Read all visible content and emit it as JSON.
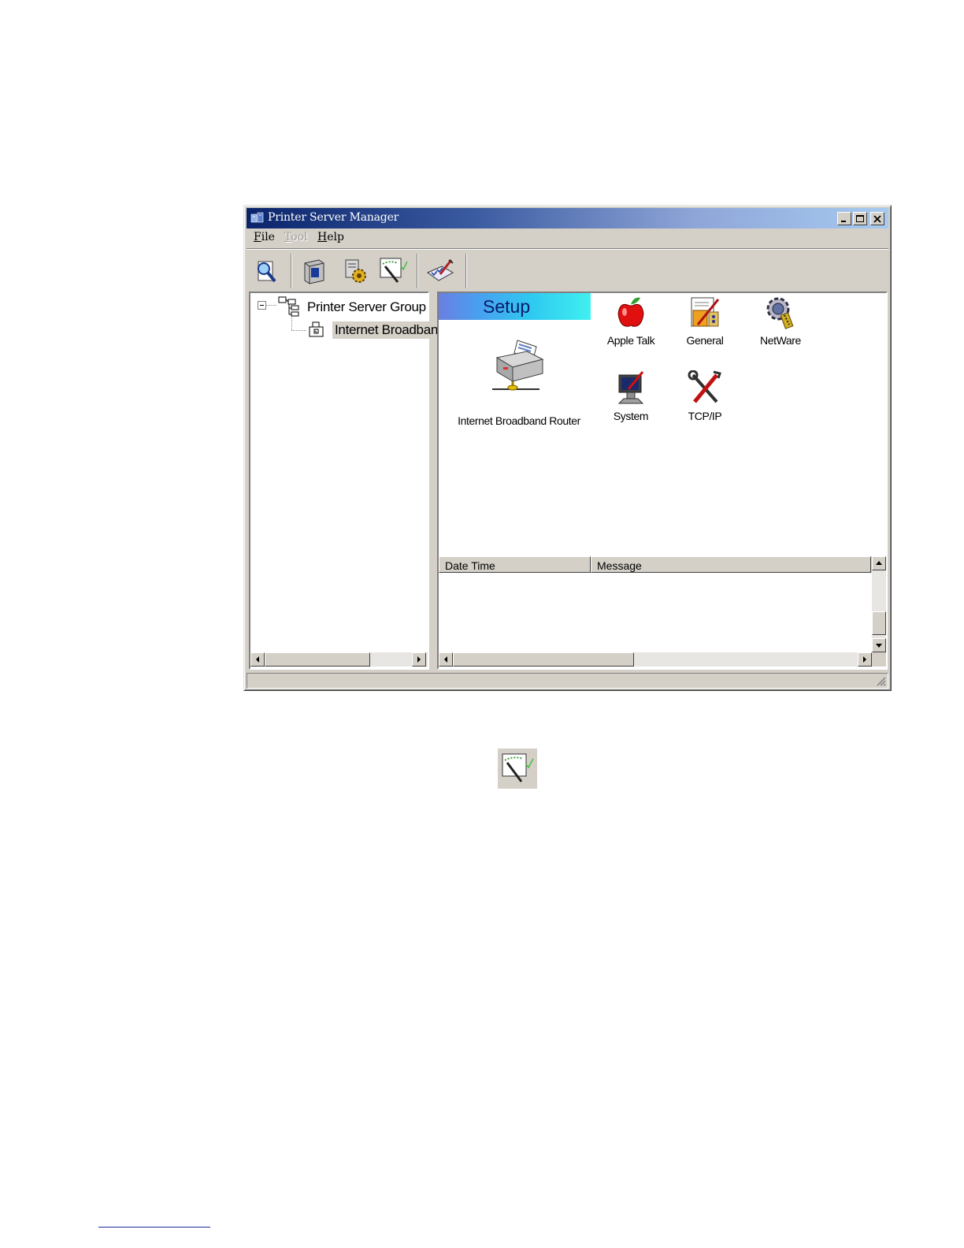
{
  "window": {
    "title": "Printer Server Manager"
  },
  "menu": {
    "items": [
      {
        "label": "File",
        "enabled": true
      },
      {
        "label": "Tool",
        "enabled": false
      },
      {
        "label": "Help",
        "enabled": true
      }
    ]
  },
  "toolbar": {
    "buttons": [
      "search-icon",
      "device-icon",
      "settings-gear-icon",
      "wizard-icon",
      "checklist-icon"
    ]
  },
  "tree": {
    "root_label": "Printer Server Group",
    "child_label": "Internet Broadband Router"
  },
  "setup": {
    "banner_label": "Setup",
    "device_label": "Internet Broadband Router",
    "icons": [
      {
        "label": "Apple Talk",
        "icon": "apple-icon"
      },
      {
        "label": "General",
        "icon": "general-icon"
      },
      {
        "label": "NetWare",
        "icon": "netware-gear-icon"
      },
      {
        "label": "System",
        "icon": "computer-icon"
      },
      {
        "label": "TCP/IP",
        "icon": "tools-icon"
      }
    ]
  },
  "log": {
    "columns": [
      "Date Time",
      "Message"
    ]
  },
  "colors": {
    "title_start": "#0a246a",
    "title_end": "#a6caf0",
    "window_face": "#d4d0c8"
  }
}
